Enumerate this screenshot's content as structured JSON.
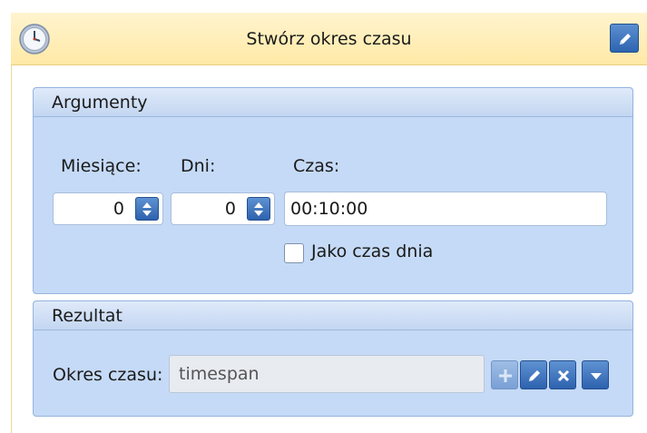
{
  "header": {
    "title": "Stwórz okres czasu",
    "icon": "clock-icon",
    "edit_icon": "pencil-icon"
  },
  "arguments": {
    "title": "Argumenty",
    "months_label": "Miesiące:",
    "months_value": "0",
    "days_label": "Dni:",
    "days_value": "0",
    "time_label": "Czas:",
    "time_value": "00:10:00",
    "time_of_day_label": "Jako czas dnia",
    "time_of_day_checked": false
  },
  "result": {
    "title": "Rezultat",
    "period_label": "Okres czasu:",
    "period_value": "timespan",
    "buttons": [
      "plus-icon",
      "pencil-icon",
      "close-icon",
      "dropdown-arrow-icon"
    ]
  },
  "colors": {
    "header_bg": "#ffe9a6",
    "group_bg": "#c5daf6",
    "button_blue": "#2e64b0"
  }
}
